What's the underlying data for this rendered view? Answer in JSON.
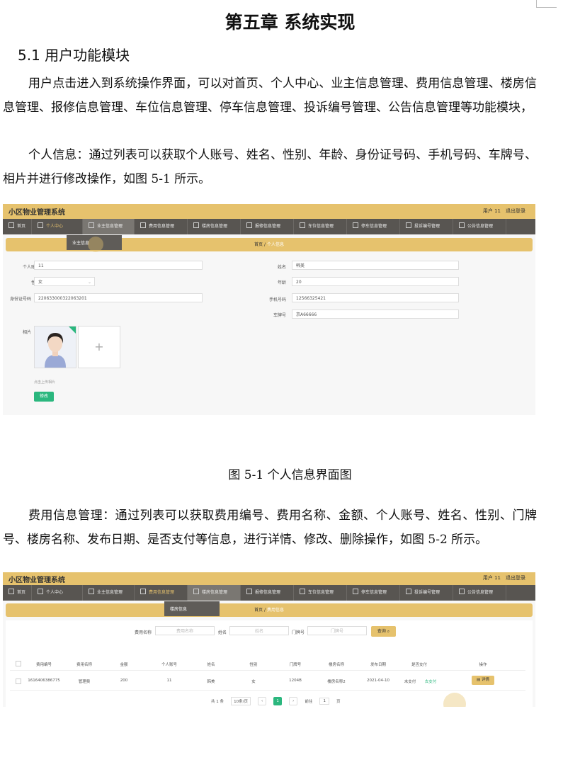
{
  "doc": {
    "chapter_title": "第五章 系统实现",
    "section_title": "5.1 用户功能模块",
    "para1": "用户点击进入到系统操作界面，可以对首页、个人中心、业主信息管理、费用信息管理、楼房信息管理、报修信息管理、车位信息管理、停车信息管理、投诉编号管理、公告信息管理等功能模块，",
    "para2": "个人信息：通过列表可以获取个人账号、姓名、性别、年龄、身份证号码、手机号码、车牌号、相片并进行修改操作，如图 5-1 所示。",
    "caption1": "图 5-1 个人信息界面图",
    "para3": "费用信息管理：通过列表可以获取费用编号、费用名称、金额、个人账号、姓名、性别、门牌号、楼房名称、发布日期、是否支付等信息，进行详情、修改、删除操作，如图 5-2 所示。"
  },
  "app": {
    "title": "小区物业管理系统",
    "user": "用户 11",
    "logout": "退出登录",
    "nav": [
      "首页",
      "个人中心",
      "业主信息管理",
      "费用信息管理",
      "楼房信息管理",
      "报修信息管理",
      "车位信息管理",
      "停车信息管理",
      "投诉编号管理",
      "公告信息管理"
    ],
    "crumb_home": "首页",
    "crumb_sep": "/"
  },
  "shot1": {
    "dropdown_item": "业主信息",
    "crumb_current": "个人信息",
    "fields": {
      "account_label": "个人账号",
      "account_value": "11",
      "name_label": "姓名",
      "name_value": "韩美",
      "gender_label": "性别",
      "gender_value": "女",
      "age_label": "年龄",
      "age_value": "20",
      "idcard_label": "身份证号码",
      "idcard_value": "220633000322063201",
      "phone_label": "手机号码",
      "phone_value": "12566325421",
      "plate_label": "车牌号",
      "plate_value": "京A66666",
      "photo_label": "相片"
    },
    "upload_plus": "+",
    "upload_tip": "点击上传相片",
    "submit": "修改"
  },
  "shot2": {
    "dropdown_item": "楼房信息",
    "crumb_current": "费用信息",
    "search": {
      "fee_name_label": "费用名称",
      "fee_name_placeholder": "费用名称",
      "name_label": "姓名",
      "name_placeholder": "姓名",
      "door_label": "门牌号",
      "door_placeholder": "门牌号",
      "button": "查询"
    },
    "headers": [
      "费用编号",
      "费用名称",
      "金额",
      "个人账号",
      "姓名",
      "性别",
      "门牌号",
      "楼房名称",
      "发布日期",
      "是否支付",
      "操作"
    ],
    "row": [
      "1616406386775",
      "管理费",
      "200",
      "11",
      "韩美",
      "女",
      "1204B",
      "楼房名称2",
      "2021-04-10",
      "未支付",
      "去支付"
    ],
    "detail_button": "详情",
    "pager": {
      "total": "共 1 条",
      "size": "10条/页",
      "page": "1",
      "goto": "前往",
      "goto_value": "1",
      "unit": "页"
    }
  }
}
